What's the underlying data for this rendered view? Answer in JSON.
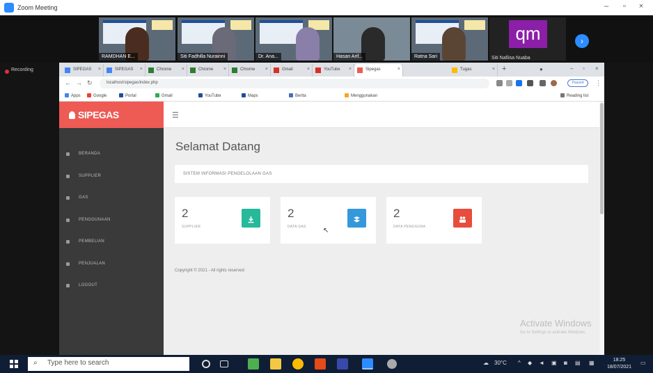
{
  "zoom": {
    "title": "Zoom Meeting",
    "recording_label": "Recording",
    "participants": [
      "RAMDHAN E...",
      "Siti Fadhilla Nurainni",
      "Dr. Ana...",
      "Hasan Arif...",
      "Ratna Sari",
      "Siti Nafiisa Nuaba"
    ],
    "avatar_text": "qm"
  },
  "browser": {
    "tabs": [
      "SIPEGAS",
      "SIPEGAS",
      "Chrome",
      "Chrome",
      "Chrome",
      "Gmail",
      "YouTube",
      "Sipegas",
      "Tugas"
    ],
    "url": "localhost/sipegas/index.php",
    "bookmarks": [
      "Apps",
      "Google",
      "Portal",
      "Gmail",
      "YouTube",
      "Maps",
      "Berita",
      "Menggunakan",
      "Reading list"
    ]
  },
  "app": {
    "brand": "SIPEGAS",
    "menu": [
      "BERANDA",
      "SUPPLIER",
      "GAS",
      "PENGGUNAAN",
      "PEMBELIAN",
      "PENJUALAN",
      "LOGOUT"
    ],
    "title": "Selamat Datang",
    "info_bar": "SISTEM INFORMASI PENGELOLAAN GAS",
    "cards": [
      {
        "number": "2",
        "label": "SUPPLIER",
        "color": "#26b99a"
      },
      {
        "number": "2",
        "label": "DATA GAS",
        "color": "#3498db"
      },
      {
        "number": "2",
        "label": "DATA PENGGUNA",
        "color": "#e74c3c"
      }
    ],
    "copyright": "Copyright © 2021 - All rights reserved"
  },
  "watermark": {
    "line1": "Activate Windows",
    "line2": "Go to Settings to activate Windows."
  },
  "taskbar": {
    "search_placeholder": "Type here to search",
    "temperature": "30°C",
    "time": "18:25",
    "date": "18/07/2021"
  }
}
